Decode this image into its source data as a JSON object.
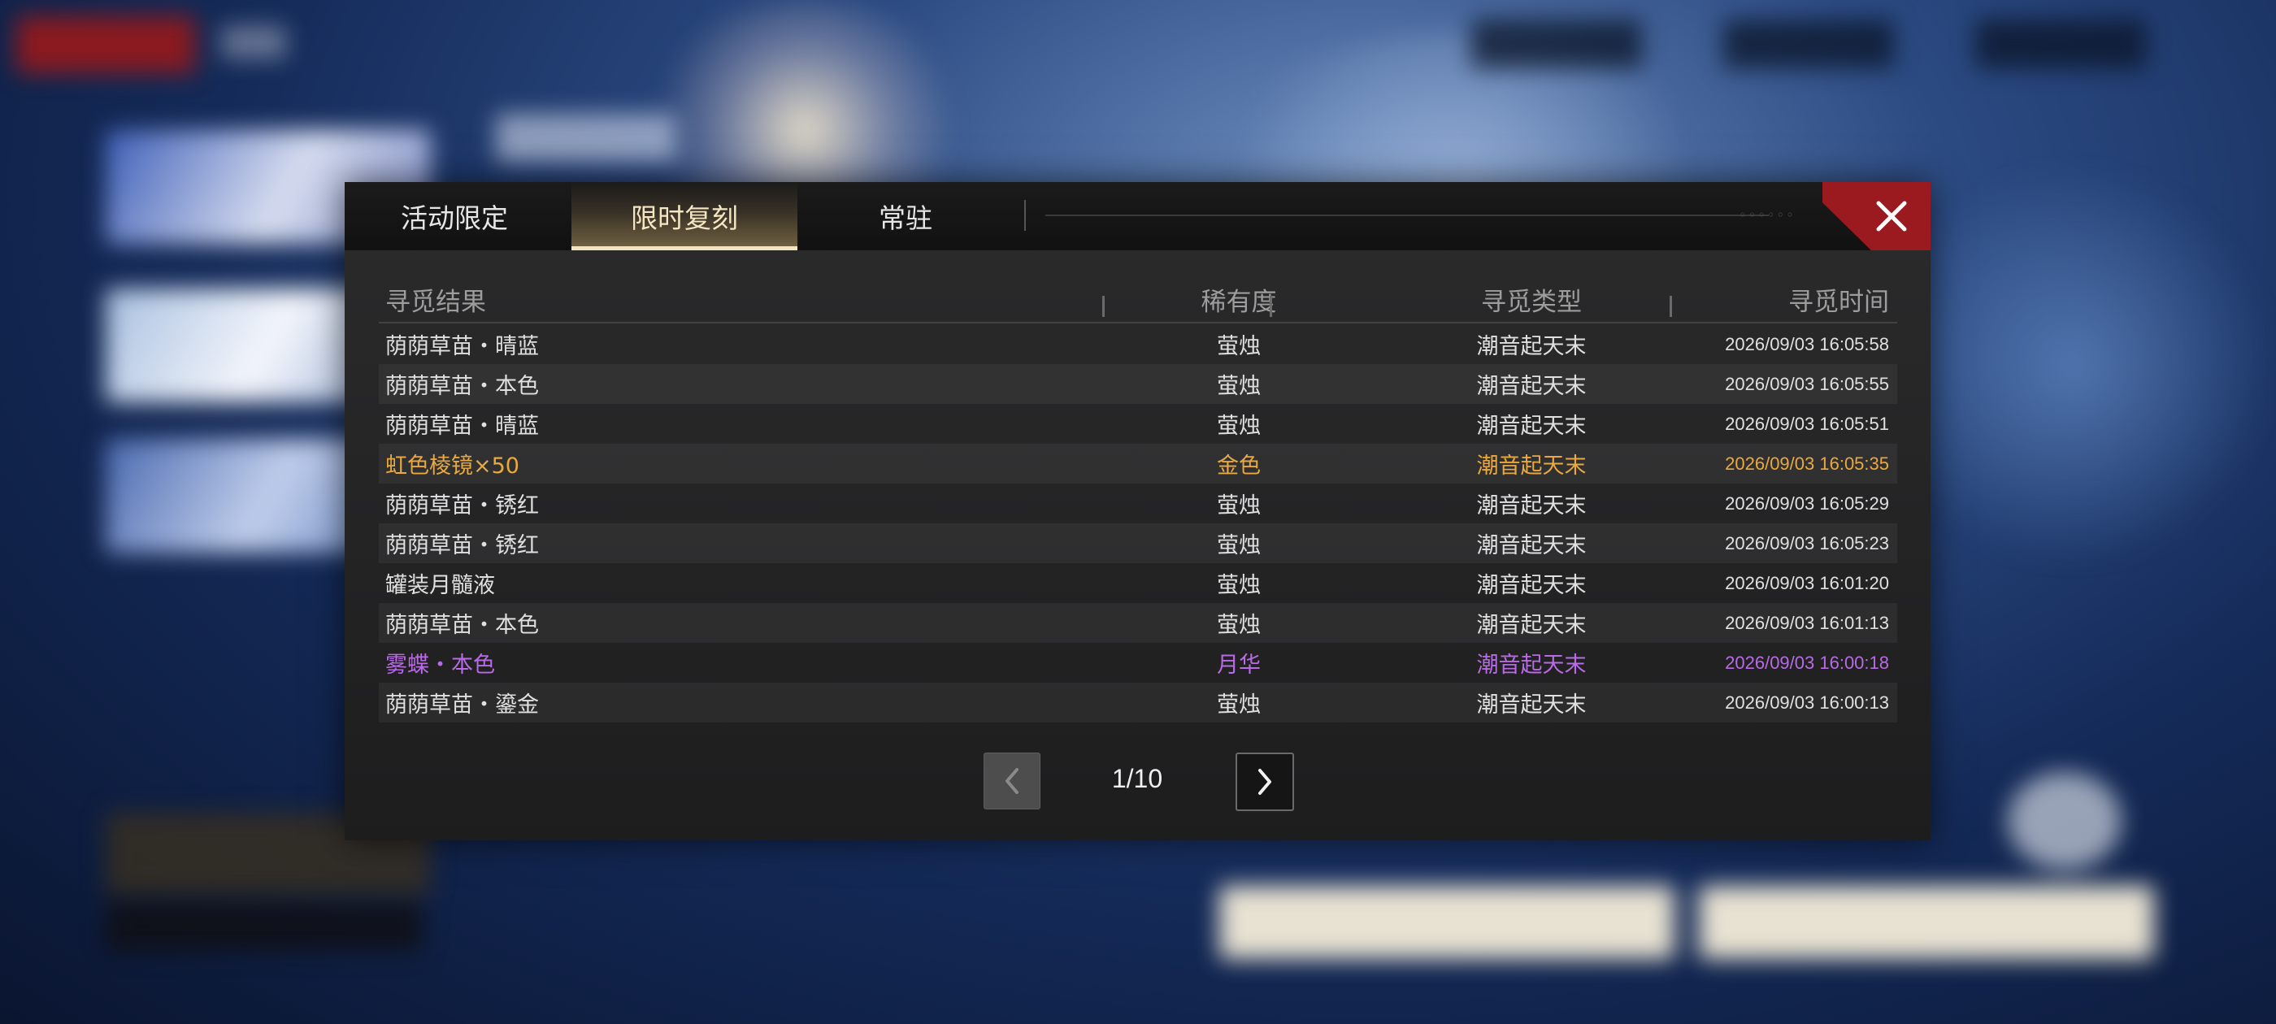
{
  "tabs": [
    {
      "label": "活动限定",
      "active": false
    },
    {
      "label": "限时复刻",
      "active": true
    },
    {
      "label": "常驻",
      "active": false
    }
  ],
  "close_icon": "close-icon",
  "table": {
    "headers": [
      "寻觅结果",
      "稀有度",
      "寻觅类型",
      "寻觅时间"
    ],
    "rows": [
      {
        "result": "荫荫草苗・晴蓝",
        "rarity": "萤烛",
        "type": "潮音起天末",
        "time": "2026/09/03 16:05:58",
        "tier": "normal"
      },
      {
        "result": "荫荫草苗・本色",
        "rarity": "萤烛",
        "type": "潮音起天末",
        "time": "2026/09/03 16:05:55",
        "tier": "normal"
      },
      {
        "result": "荫荫草苗・晴蓝",
        "rarity": "萤烛",
        "type": "潮音起天末",
        "time": "2026/09/03 16:05:51",
        "tier": "normal"
      },
      {
        "result": "虹色棱镜×50",
        "rarity": "金色",
        "type": "潮音起天末",
        "time": "2026/09/03 16:05:35",
        "tier": "gold"
      },
      {
        "result": "荫荫草苗・锈红",
        "rarity": "萤烛",
        "type": "潮音起天末",
        "time": "2026/09/03 16:05:29",
        "tier": "normal"
      },
      {
        "result": "荫荫草苗・锈红",
        "rarity": "萤烛",
        "type": "潮音起天末",
        "time": "2026/09/03 16:05:23",
        "tier": "normal"
      },
      {
        "result": "罐装月髓液",
        "rarity": "萤烛",
        "type": "潮音起天末",
        "time": "2026/09/03 16:01:20",
        "tier": "normal"
      },
      {
        "result": "荫荫草苗・本色",
        "rarity": "萤烛",
        "type": "潮音起天末",
        "time": "2026/09/03 16:01:13",
        "tier": "normal"
      },
      {
        "result": "雾蝶・本色",
        "rarity": "月华",
        "type": "潮音起天末",
        "time": "2026/09/03 16:00:18",
        "tier": "purple"
      },
      {
        "result": "荫荫草苗・鎏金",
        "rarity": "萤烛",
        "type": "潮音起天末",
        "time": "2026/09/03 16:00:13",
        "tier": "normal"
      }
    ]
  },
  "pagination": {
    "text": "1/10",
    "current": 1,
    "total": 10
  },
  "colors": {
    "gold": "#e9a940",
    "purple": "#b96ae6",
    "close_red": "#9b1a1f",
    "active_tab_text": "#f5e6c3"
  }
}
